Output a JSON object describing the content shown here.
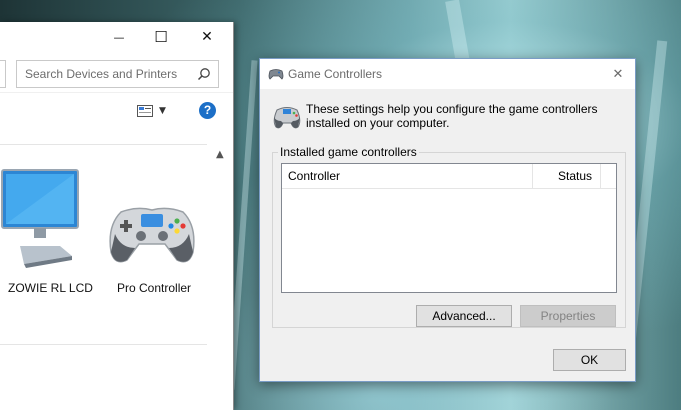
{
  "explorer": {
    "search": {
      "placeholder": "Search Devices and Printers"
    },
    "caption_buttons": {
      "minimize": "—",
      "maximize": "☐",
      "close": "✕"
    },
    "toolbar": {
      "help": "?"
    },
    "devices": [
      {
        "label": "ZOWIE RL LCD",
        "icon": "monitor-icon"
      },
      {
        "label": "Pro Controller",
        "icon": "gamepad-icon"
      }
    ]
  },
  "dialog": {
    "title": "Game Controllers",
    "close": "✕",
    "intro": "These settings help you configure the game controllers installed on your computer.",
    "group_label": "Installed game controllers",
    "columns": {
      "controller": "Controller",
      "status": "Status"
    },
    "controllers": [],
    "buttons": {
      "advanced": "Advanced...",
      "properties": "Properties",
      "ok": "OK"
    }
  },
  "colors": {
    "accent": "#1c6fc7",
    "dialog_bg": "#f0f0f0",
    "monitor_blue": "#3aa0e8"
  }
}
